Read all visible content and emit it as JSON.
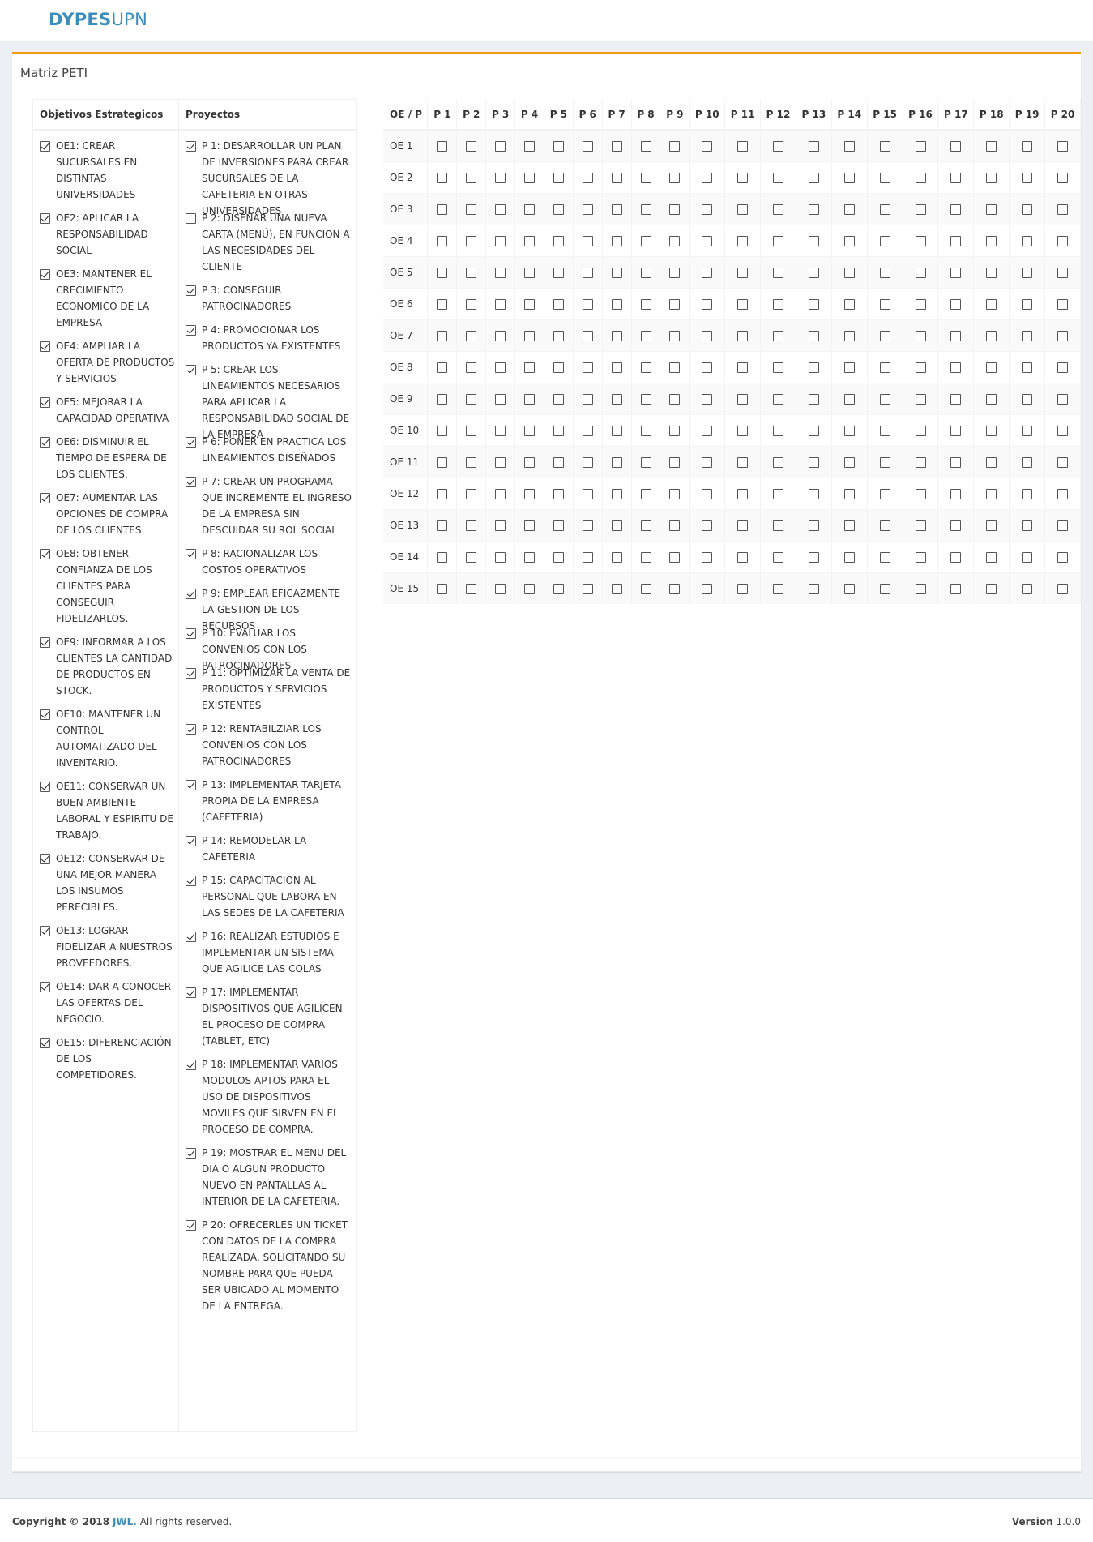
{
  "brand": {
    "bold": "DYPES",
    "rest": "UPN",
    "color": "#3c8dbc"
  },
  "box": {
    "title": "Matriz PETI",
    "accent_color": "#f39c12"
  },
  "objectives": {
    "header": "Objetivos Estrategicos",
    "items": [
      {
        "label": "OE1: CREAR SUCURSALES EN DISTINTAS UNIVERSIDADES",
        "checked": true
      },
      {
        "label": "OE2: APLICAR LA RESPONSABILIDAD SOCIAL",
        "checked": true
      },
      {
        "label": "OE3: MANTENER EL CRECIMIENTO ECONOMICO DE LA EMPRESA",
        "checked": true
      },
      {
        "label": "OE4: AMPLIAR LA OFERTA DE PRODUCTOS Y SERVICIOS",
        "checked": true
      },
      {
        "label": "OE5: MEJORAR LA CAPACIDAD OPERATIVA",
        "checked": true
      },
      {
        "label": "OE6: DISMINUIR EL TIEMPO DE ESPERA DE LOS CLIENTES.",
        "checked": true
      },
      {
        "label": "OE7: AUMENTAR LAS OPCIONES DE COMPRA DE LOS CLIENTES.",
        "checked": true
      },
      {
        "label": "OE8: OBTENER CONFIANZA DE LOS CLIENTES PARA CONSEGUIR FIDELIZARLOS.",
        "checked": true
      },
      {
        "label": "OE9: INFORMAR A LOS CLIENTES LA CANTIDAD DE PRODUCTOS EN STOCK.",
        "checked": true
      },
      {
        "label": "OE10: MANTENER UN CONTROL AUTOMATIZADO DEL INVENTARIO.",
        "checked": true
      },
      {
        "label": "OE11: CONSERVAR UN BUEN AMBIENTE LABORAL Y ESPIRITU DE TRABAJO.",
        "checked": true
      },
      {
        "label": "OE12: CONSERVAR DE UNA MEJOR MANERA LOS INSUMOS PERECIBLES.",
        "checked": true
      },
      {
        "label": "OE13: LOGRAR FIDELIZAR A NUESTROS PROVEEDORES.",
        "checked": true
      },
      {
        "label": "OE14: DAR A CONOCER LAS OFERTAS DEL NEGOCIO.",
        "checked": true
      },
      {
        "label": "OE15: DIFERENCIACIÓN DE LOS COMPETIDORES.",
        "checked": true
      }
    ]
  },
  "projects": {
    "header": "Proyectos",
    "items": [
      {
        "label": "P 1: DESARROLLAR UN PLAN DE INVERSIONES PARA CREAR SUCURSALES DE LA CAFETERIA EN OTRAS UNIVERSIDADES",
        "checked": true
      },
      {
        "label": "P 2: DISEÑAR UNA NUEVA CARTA (MENÚ), EN FUNCION A LAS NECESIDADES DEL CLIENTE",
        "checked": false
      },
      {
        "label": "P 3: CONSEGUIR PATROCINADORES",
        "checked": true
      },
      {
        "label": "P 4: PROMOCIONAR LOS PRODUCTOS YA EXISTENTES",
        "checked": true
      },
      {
        "label": "P 5: CREAR LOS LINEAMIENTOS NECESARIOS PARA APLICAR LA RESPONSABILIDAD SOCIAL DE LA EMPRESA",
        "checked": true
      },
      {
        "label": "P 6: PONER EN PRACTICA LOS LINEAMIENTOS DISEÑADOS",
        "checked": true
      },
      {
        "label": "P 7: CREAR UN PROGRAMA QUE INCREMENTE EL INGRESO DE LA EMPRESA SIN DESCUIDAR SU ROL SOCIAL",
        "checked": true
      },
      {
        "label": "P 8: RACIONALIZAR LOS COSTOS OPERATIVOS",
        "checked": true
      },
      {
        "label": "P 9: EMPLEAR EFICAZMENTE LA GESTION DE LOS RECURSOS",
        "checked": true
      },
      {
        "label": "P 10: EVALUAR LOS CONVENIOS CON LOS PATROCINADORES",
        "checked": true
      },
      {
        "label": "P 11: OPTIMIZAR LA VENTA DE PRODUCTOS Y SERVICIOS EXISTENTES",
        "checked": true
      },
      {
        "label": "P 12: RENTABILZIAR LOS CONVENIOS CON LOS PATROCINADORES",
        "checked": true
      },
      {
        "label": "P 13: IMPLEMENTAR TARJETA PROPIA DE LA EMPRESA (CAFETERIA)",
        "checked": true
      },
      {
        "label": "P 14: REMODELAR LA CAFETERIA",
        "checked": true
      },
      {
        "label": "P 15: CAPACITACION AL PERSONAL QUE LABORA EN LAS SEDES DE LA CAFETERIA",
        "checked": true
      },
      {
        "label": "P 16: REALIZAR ESTUDIOS E IMPLEMENTAR UN SISTEMA QUE AGILICE LAS COLAS",
        "checked": true
      },
      {
        "label": "P 17: IMPLEMENTAR DISPOSITIVOS QUE AGILICEN EL PROCESO DE COMPRA (TABLET, ETC)",
        "checked": true
      },
      {
        "label": "P 18: IMPLEMENTAR VARIOS MODULOS APTOS PARA EL USO DE DISPOSITIVOS MOVILES QUE SIRVEN EN EL PROCESO DE COMPRA.",
        "checked": true
      },
      {
        "label": "P 19: MOSTRAR EL MENU DEL DIA O ALGUN PRODUCTO NUEVO EN PANTALLAS AL INTERIOR DE LA CAFETERIA.",
        "checked": true
      },
      {
        "label": "P 20: OFRECERLES UN TICKET CON DATOS DE LA COMPRA REALIZADA, SOLICITANDO SU NOMBRE PARA QUE PUEDA SER UBICADO AL MOMENTO DE LA ENTREGA.",
        "checked": true
      }
    ]
  },
  "matrix": {
    "corner": "OE / P",
    "columns": [
      "P 1",
      "P 2",
      "P 3",
      "P 4",
      "P 5",
      "P 6",
      "P 7",
      "P 8",
      "P 9",
      "P 10",
      "P 11",
      "P 12",
      "P 13",
      "P 14",
      "P 15",
      "P 16",
      "P 17",
      "P 18",
      "P 19",
      "P 20"
    ],
    "rows": [
      "OE 1",
      "OE 2",
      "OE 3",
      "OE 4",
      "OE 5",
      "OE 6",
      "OE 7",
      "OE 8",
      "OE 9",
      "OE 10",
      "OE 11",
      "OE 12",
      "OE 13",
      "OE 14",
      "OE 15"
    ]
  },
  "footer": {
    "copyright_prefix": "Copyright © 2018",
    "company": "JWL.",
    "rights": "All rights reserved.",
    "version_label": "Version",
    "version_value": "1.0.0"
  }
}
